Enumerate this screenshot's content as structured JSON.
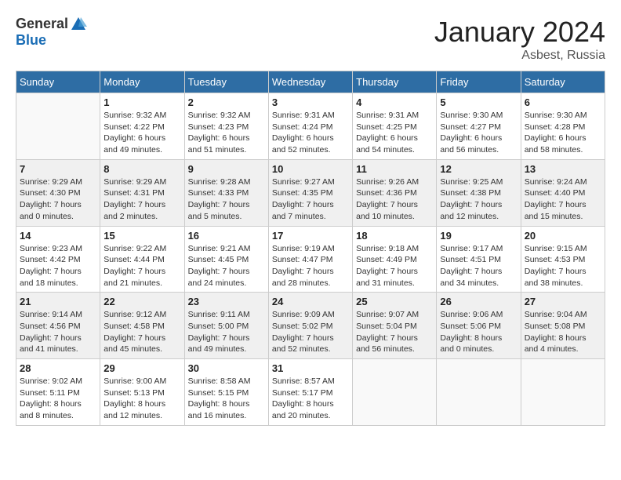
{
  "header": {
    "logo_general": "General",
    "logo_blue": "Blue",
    "month": "January 2024",
    "location": "Asbest, Russia"
  },
  "days_of_week": [
    "Sunday",
    "Monday",
    "Tuesday",
    "Wednesday",
    "Thursday",
    "Friday",
    "Saturday"
  ],
  "weeks": [
    [
      {
        "day": "",
        "info": ""
      },
      {
        "day": "1",
        "info": "Sunrise: 9:32 AM\nSunset: 4:22 PM\nDaylight: 6 hours\nand 49 minutes."
      },
      {
        "day": "2",
        "info": "Sunrise: 9:32 AM\nSunset: 4:23 PM\nDaylight: 6 hours\nand 51 minutes."
      },
      {
        "day": "3",
        "info": "Sunrise: 9:31 AM\nSunset: 4:24 PM\nDaylight: 6 hours\nand 52 minutes."
      },
      {
        "day": "4",
        "info": "Sunrise: 9:31 AM\nSunset: 4:25 PM\nDaylight: 6 hours\nand 54 minutes."
      },
      {
        "day": "5",
        "info": "Sunrise: 9:30 AM\nSunset: 4:27 PM\nDaylight: 6 hours\nand 56 minutes."
      },
      {
        "day": "6",
        "info": "Sunrise: 9:30 AM\nSunset: 4:28 PM\nDaylight: 6 hours\nand 58 minutes."
      }
    ],
    [
      {
        "day": "7",
        "info": "Sunrise: 9:29 AM\nSunset: 4:30 PM\nDaylight: 7 hours\nand 0 minutes."
      },
      {
        "day": "8",
        "info": "Sunrise: 9:29 AM\nSunset: 4:31 PM\nDaylight: 7 hours\nand 2 minutes."
      },
      {
        "day": "9",
        "info": "Sunrise: 9:28 AM\nSunset: 4:33 PM\nDaylight: 7 hours\nand 5 minutes."
      },
      {
        "day": "10",
        "info": "Sunrise: 9:27 AM\nSunset: 4:35 PM\nDaylight: 7 hours\nand 7 minutes."
      },
      {
        "day": "11",
        "info": "Sunrise: 9:26 AM\nSunset: 4:36 PM\nDaylight: 7 hours\nand 10 minutes."
      },
      {
        "day": "12",
        "info": "Sunrise: 9:25 AM\nSunset: 4:38 PM\nDaylight: 7 hours\nand 12 minutes."
      },
      {
        "day": "13",
        "info": "Sunrise: 9:24 AM\nSunset: 4:40 PM\nDaylight: 7 hours\nand 15 minutes."
      }
    ],
    [
      {
        "day": "14",
        "info": "Sunrise: 9:23 AM\nSunset: 4:42 PM\nDaylight: 7 hours\nand 18 minutes."
      },
      {
        "day": "15",
        "info": "Sunrise: 9:22 AM\nSunset: 4:44 PM\nDaylight: 7 hours\nand 21 minutes."
      },
      {
        "day": "16",
        "info": "Sunrise: 9:21 AM\nSunset: 4:45 PM\nDaylight: 7 hours\nand 24 minutes."
      },
      {
        "day": "17",
        "info": "Sunrise: 9:19 AM\nSunset: 4:47 PM\nDaylight: 7 hours\nand 28 minutes."
      },
      {
        "day": "18",
        "info": "Sunrise: 9:18 AM\nSunset: 4:49 PM\nDaylight: 7 hours\nand 31 minutes."
      },
      {
        "day": "19",
        "info": "Sunrise: 9:17 AM\nSunset: 4:51 PM\nDaylight: 7 hours\nand 34 minutes."
      },
      {
        "day": "20",
        "info": "Sunrise: 9:15 AM\nSunset: 4:53 PM\nDaylight: 7 hours\nand 38 minutes."
      }
    ],
    [
      {
        "day": "21",
        "info": "Sunrise: 9:14 AM\nSunset: 4:56 PM\nDaylight: 7 hours\nand 41 minutes."
      },
      {
        "day": "22",
        "info": "Sunrise: 9:12 AM\nSunset: 4:58 PM\nDaylight: 7 hours\nand 45 minutes."
      },
      {
        "day": "23",
        "info": "Sunrise: 9:11 AM\nSunset: 5:00 PM\nDaylight: 7 hours\nand 49 minutes."
      },
      {
        "day": "24",
        "info": "Sunrise: 9:09 AM\nSunset: 5:02 PM\nDaylight: 7 hours\nand 52 minutes."
      },
      {
        "day": "25",
        "info": "Sunrise: 9:07 AM\nSunset: 5:04 PM\nDaylight: 7 hours\nand 56 minutes."
      },
      {
        "day": "26",
        "info": "Sunrise: 9:06 AM\nSunset: 5:06 PM\nDaylight: 8 hours\nand 0 minutes."
      },
      {
        "day": "27",
        "info": "Sunrise: 9:04 AM\nSunset: 5:08 PM\nDaylight: 8 hours\nand 4 minutes."
      }
    ],
    [
      {
        "day": "28",
        "info": "Sunrise: 9:02 AM\nSunset: 5:11 PM\nDaylight: 8 hours\nand 8 minutes."
      },
      {
        "day": "29",
        "info": "Sunrise: 9:00 AM\nSunset: 5:13 PM\nDaylight: 8 hours\nand 12 minutes."
      },
      {
        "day": "30",
        "info": "Sunrise: 8:58 AM\nSunset: 5:15 PM\nDaylight: 8 hours\nand 16 minutes."
      },
      {
        "day": "31",
        "info": "Sunrise: 8:57 AM\nSunset: 5:17 PM\nDaylight: 8 hours\nand 20 minutes."
      },
      {
        "day": "",
        "info": ""
      },
      {
        "day": "",
        "info": ""
      },
      {
        "day": "",
        "info": ""
      }
    ]
  ]
}
